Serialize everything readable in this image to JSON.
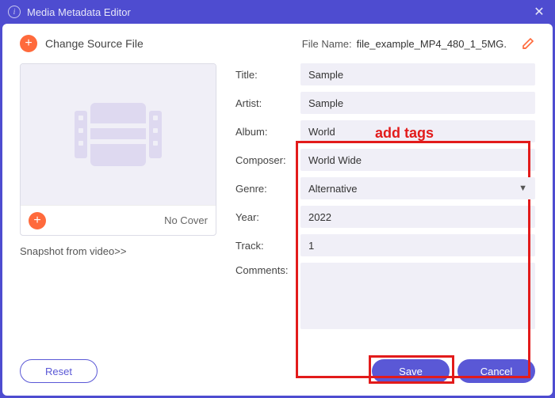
{
  "window": {
    "title": "Media Metadata Editor"
  },
  "header": {
    "change_source": "Change Source File",
    "filename_label": "File Name:",
    "filename_value": "file_example_MP4_480_1_5MG."
  },
  "annotation": {
    "add_tags": "add tags"
  },
  "cover": {
    "no_cover": "No Cover",
    "snapshot_link": "Snapshot from video>>"
  },
  "form": {
    "labels": {
      "title": "Title:",
      "artist": "Artist:",
      "album": "Album:",
      "composer": "Composer:",
      "genre": "Genre:",
      "year": "Year:",
      "track": "Track:",
      "comments": "Comments:"
    },
    "values": {
      "title": "Sample",
      "artist": "Sample",
      "album": "World",
      "composer": "World Wide",
      "genre": "Alternative",
      "year": "2022",
      "track": "1",
      "comments": ""
    }
  },
  "footer": {
    "reset": "Reset",
    "save": "Save",
    "cancel": "Cancel"
  }
}
